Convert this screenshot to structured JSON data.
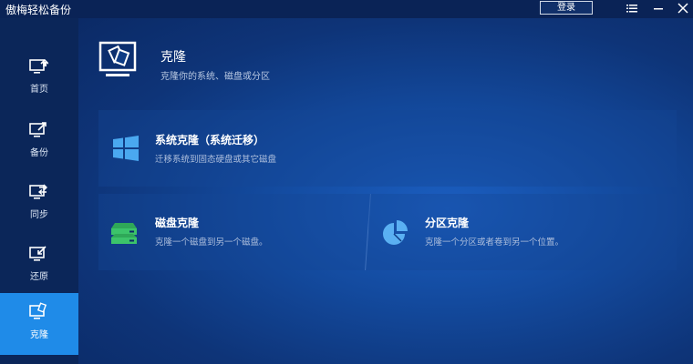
{
  "app": {
    "title": "傲梅轻松备份",
    "login_label": "登录"
  },
  "sidebar": {
    "items": [
      {
        "label": "首页",
        "icon": "home-icon"
      },
      {
        "label": "备份",
        "icon": "backup-icon"
      },
      {
        "label": "同步",
        "icon": "sync-icon"
      },
      {
        "label": "还原",
        "icon": "restore-icon"
      },
      {
        "label": "克隆",
        "icon": "clone-icon",
        "active": true
      }
    ]
  },
  "header": {
    "title": "克隆",
    "description": "克隆你的系统、磁盘或分区"
  },
  "cards": {
    "system": {
      "title": "系统克隆（系统迁移）",
      "description": "迁移系统到固态硬盘或其它磁盘",
      "icon": "windows-icon"
    },
    "disk": {
      "title": "磁盘克隆",
      "description": "克隆一个磁盘到另一个磁盘。",
      "icon": "disk-icon"
    },
    "partition": {
      "title": "分区克隆",
      "description": "克隆一个分区或者卷到另一个位置。",
      "icon": "pie-chart-icon"
    }
  },
  "colors": {
    "accent": "#1f8be8",
    "sidebar_bg": "#0b2659",
    "titlebar_bg": "#0a2356",
    "disk_icon": "#3cc46a",
    "system_icon": "#4aa8f0",
    "partition_icon": "#5ab0f2"
  }
}
